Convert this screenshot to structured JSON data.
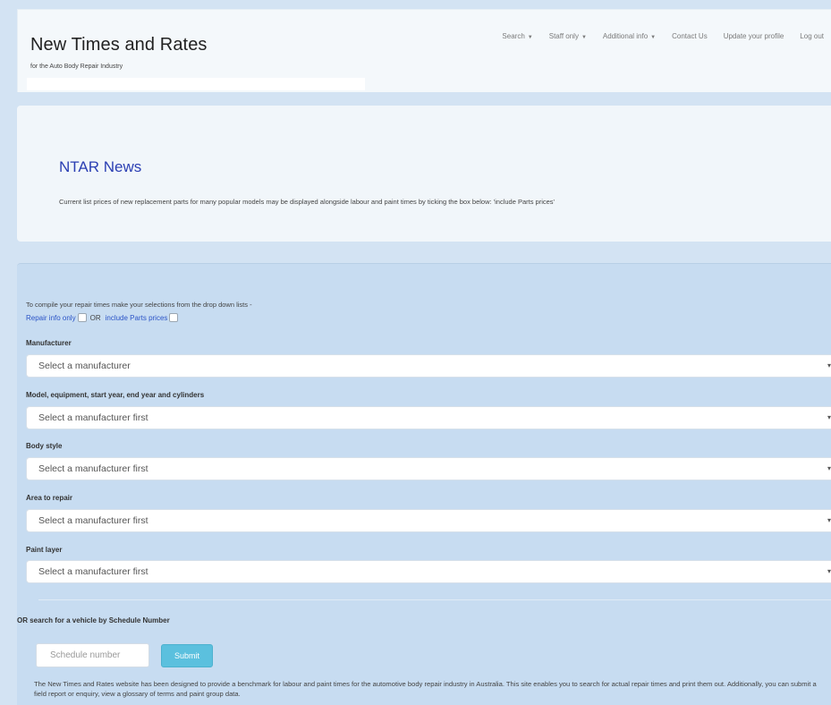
{
  "header": {
    "brand": "New Times and Rates",
    "tagline": "for the Auto Body Repair Industry",
    "nav": [
      {
        "label": "Search",
        "dropdown": true
      },
      {
        "label": "Staff only",
        "dropdown": true
      },
      {
        "label": "Additional info",
        "dropdown": true
      },
      {
        "label": "Contact Us",
        "dropdown": false
      },
      {
        "label": "Update your profile",
        "dropdown": false
      },
      {
        "label": "Log out",
        "dropdown": false
      }
    ]
  },
  "news": {
    "title": "NTAR News",
    "text": "Current list prices of new replacement parts for many popular models may be displayed alongside labour and paint times by ticking the box below: 'include Parts prices'"
  },
  "form": {
    "intro": "To compile your repair times make your selections from the drop down lists -",
    "option_repair": "Repair info only",
    "option_or": "OR",
    "option_parts": "include Parts prices",
    "fields": [
      {
        "label": "Manufacturer",
        "value": "Select a manufacturer"
      },
      {
        "label": "Model, equipment, start year, end year and cylinders",
        "value": "Select a manufacturer first"
      },
      {
        "label": "Body style",
        "value": "Select a manufacturer first"
      },
      {
        "label": "Area to repair",
        "value": "Select a manufacturer first"
      },
      {
        "label": "Paint layer",
        "value": "Select a manufacturer first"
      }
    ],
    "schedule_label": "OR  search for a vehicle by Schedule Number",
    "schedule_placeholder": "Schedule number",
    "submit_label": "Submit",
    "about": "The New Times and Rates website has been designed to provide a benchmark for labour and paint times for the automotive body repair industry in Australia. This site enables you to search for actual repair times and print them out. Additionally, you can submit a field report or enquiry, view a glossary of terms and paint group data."
  },
  "colors": {
    "background": "#d3e3f3",
    "news_title": "#2b3fb3",
    "link": "#2b54c7",
    "submit": "#5bc0de"
  }
}
